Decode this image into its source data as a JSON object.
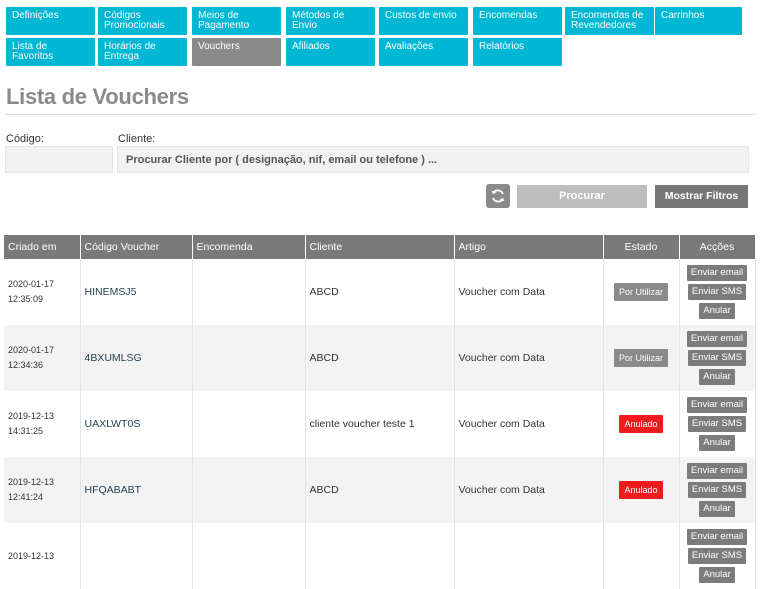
{
  "nav": {
    "tabs": [
      {
        "label": "Definições"
      },
      {
        "label": "Códigos Promocionais"
      },
      {
        "label": "Meios de Pagamento"
      },
      {
        "label": "Métodos de Envio"
      },
      {
        "label": "Custos de envio"
      },
      {
        "label": "Encomendas"
      },
      {
        "label": "Encomendas de Revendedores"
      },
      {
        "label": "Carrinhos"
      },
      {
        "label": "Lista de Favoritos"
      },
      {
        "label": "Horários de Entrega"
      },
      {
        "label": "Vouchers"
      },
      {
        "label": "Afiliados"
      },
      {
        "label": "Avaliações"
      },
      {
        "label": "Relatórios"
      }
    ],
    "active": "Vouchers"
  },
  "page": {
    "title": "Lista de Vouchers"
  },
  "filters": {
    "code_label": "Código:",
    "code_value": "",
    "client_label": "Cliente:",
    "client_placeholder": "Procurar Cliente por ( designação, nif, email ou telefone ) ...",
    "search_label": "Procurar",
    "show_filters_label": "Mostrar Filtros"
  },
  "table": {
    "headers": [
      "Criado em",
      "Código Voucher",
      "Encomenda",
      "Cliente",
      "Artigo",
      "Estado",
      "Acções"
    ],
    "actions": {
      "email": "Enviar email",
      "sms": "Enviar SMS",
      "cancel": "Anular"
    },
    "rows": [
      {
        "date": "2020-01-17",
        "time": "12:35:09",
        "code": "HINEMSJ5",
        "order": "",
        "client": "ABCD",
        "item": "Voucher com Data",
        "status": "Por Utilizar",
        "status_type": "pending"
      },
      {
        "date": "2020-01-17",
        "time": "12:34:36",
        "code": "4BXUMLSG",
        "order": "",
        "client": "ABCD",
        "item": "Voucher com Data",
        "status": "Por Utilizar",
        "status_type": "pending"
      },
      {
        "date": "2019-12-13",
        "time": "14:31:25",
        "code": "UAXLWT0S",
        "order": "",
        "client": "cliente voucher teste 1",
        "item": "Voucher com Data",
        "status": "Anulado",
        "status_type": "void"
      },
      {
        "date": "2019-12-13",
        "time": "12:41:24",
        "code": "HFQABABT",
        "order": "",
        "client": "ABCD",
        "item": "Voucher com Data",
        "status": "Anulado",
        "status_type": "void"
      },
      {
        "date": "2019-12-13",
        "time": "",
        "code": "",
        "order": "",
        "client": "",
        "item": "",
        "status": "",
        "status_type": "pending"
      }
    ]
  },
  "colors": {
    "tab": "#00b7d4",
    "tab_active": "#8a8a8a",
    "header": "#7a7a7a",
    "void": "#ee1c1c",
    "pending": "#8a8a8a"
  }
}
